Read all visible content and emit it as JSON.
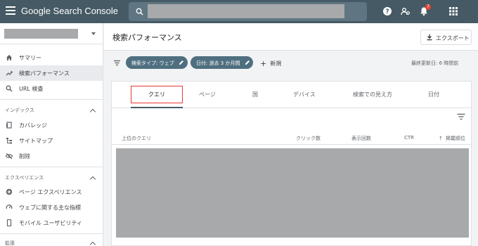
{
  "app": {
    "title": "Google Search Console"
  },
  "search": {
    "placeholder": ""
  },
  "topbar": {
    "notification_count": "7"
  },
  "sidebar": {
    "items": [
      {
        "label": "サマリー",
        "icon": "home-icon"
      },
      {
        "label": "検索パフォーマンス",
        "icon": "trending-icon",
        "active": true
      },
      {
        "label": "URL 検査",
        "icon": "search-icon"
      }
    ],
    "sections": [
      {
        "title": "インデックス",
        "items": [
          {
            "label": "カバレッジ",
            "icon": "coverage-icon"
          },
          {
            "label": "サイトマップ",
            "icon": "sitemap-icon"
          },
          {
            "label": "削除",
            "icon": "removals-icon"
          }
        ]
      },
      {
        "title": "エクスペリエンス",
        "items": [
          {
            "label": "ページ エクスペリエンス",
            "icon": "page-experience-icon"
          },
          {
            "label": "ウェブに関する主な指標",
            "icon": "web-vitals-icon"
          },
          {
            "label": "モバイル ユーザビリティ",
            "icon": "mobile-icon"
          }
        ]
      },
      {
        "title": "拡張"
      }
    ]
  },
  "header": {
    "title": "検索パフォーマンス",
    "export_label": "エクスポート"
  },
  "filters": {
    "chips": [
      "検索タイプ: ウェブ",
      "日付: 過去 3 か月間"
    ],
    "add_new_label": "新規",
    "last_updated": "最終更新日: 6 時間前"
  },
  "tabs": [
    {
      "label": "クエリ",
      "active": true
    },
    {
      "label": "ページ"
    },
    {
      "label": "国"
    },
    {
      "label": "デバイス"
    },
    {
      "label": "検索での見え方"
    },
    {
      "label": "日付"
    }
  ],
  "table": {
    "columns": [
      "上位のクエリ",
      "クリック数",
      "表示回数",
      "CTR",
      "掲載順位"
    ]
  },
  "colors": {
    "topbar": "#455a64",
    "chip": "#4f6f80",
    "highlight": "#e53935"
  }
}
